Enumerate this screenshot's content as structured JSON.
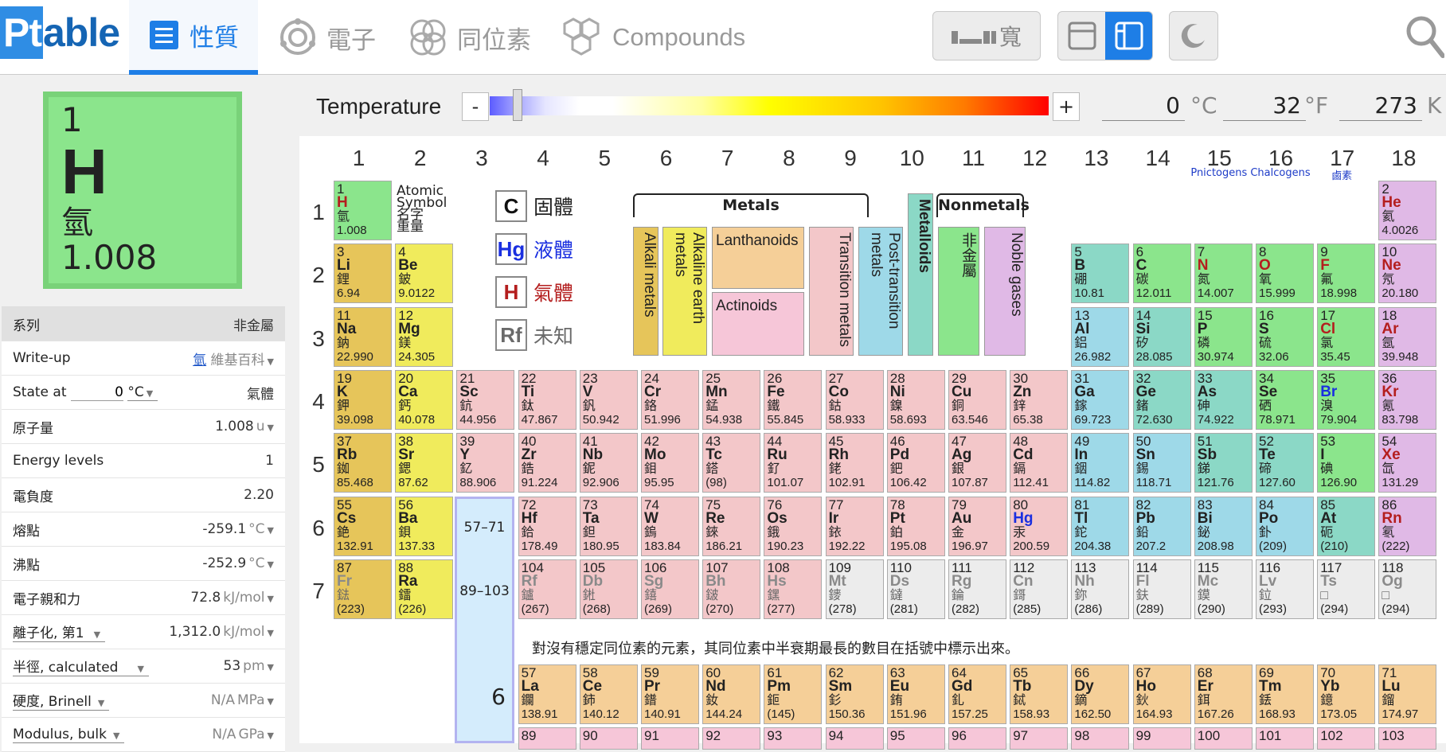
{
  "nav": {
    "logo": "Ptable",
    "logo_pt": "Pt",
    "logo_rest": "able",
    "tabs": [
      {
        "label": "性質",
        "icon": "list-icon",
        "active": true
      },
      {
        "label": "電子",
        "icon": "electron-icon",
        "active": false
      },
      {
        "label": "同位素",
        "icon": "isotope-icon",
        "active": false
      },
      {
        "label": "Compounds",
        "icon": "compound-icon",
        "active": false
      }
    ],
    "wide_label": "寬"
  },
  "selected": {
    "number": "1",
    "symbol": "H",
    "name": "氫",
    "mass": "1.008"
  },
  "props": {
    "series_label": "系列",
    "series_value": "非金屬",
    "writeup_label": "Write-up",
    "writeup_link": "氫",
    "writeup_source": "維基百科",
    "state_label": "State at",
    "state_temp": "0",
    "state_unit": "°C",
    "state_value": "氣體",
    "mass_label": "原子量",
    "mass_value": "1.008",
    "mass_unit": "u",
    "energy_label": "Energy levels",
    "energy_value": "1",
    "eneg_label": "電負度",
    "eneg_value": "2.20",
    "melt_label": "熔點",
    "melt_value": "-259.1",
    "melt_unit": "°C",
    "boil_label": "沸點",
    "boil_value": "-252.9",
    "boil_unit": "°C",
    "affinity_label": "電子親和力",
    "affinity_value": "72.8",
    "affinity_unit": "kJ/mol",
    "ion_label": "離子化, 第1",
    "ion_value": "1,312.0",
    "ion_unit": "kJ/mol",
    "radius_label": "半徑, calculated",
    "radius_value": "53",
    "radius_unit": "pm",
    "hardness_label": "硬度, Brinell",
    "hardness_value": "N/A",
    "hardness_unit": "MPa",
    "modulus_label": "Modulus, bulk",
    "modulus_value": "N/A",
    "modulus_unit": "GPa"
  },
  "temperature": {
    "label": "Temperature",
    "minus": "-",
    "plus": "+",
    "c_value": "0",
    "c_unit": "°C",
    "f_value": "32",
    "f_unit": "°F",
    "k_value": "273",
    "k_unit": "K"
  },
  "groups": [
    "1",
    "2",
    "3",
    "4",
    "5",
    "6",
    "7",
    "8",
    "9",
    "10",
    "11",
    "12",
    "13",
    "14",
    "15",
    "16",
    "17",
    "18"
  ],
  "group_subs": {
    "15": "Pnictogens",
    "16": "Chalcogens",
    "17": "鹵素"
  },
  "periods": [
    "1",
    "2",
    "3",
    "4",
    "5",
    "6",
    "7"
  ],
  "legend": {
    "atomic": "Atomic",
    "symbol": "Symbol",
    "name": "名字",
    "weight": "重量",
    "solid_sym": "C",
    "solid": "固體",
    "liquid_sym": "Hg",
    "liquid": "液體",
    "gas_sym": "H",
    "gas": "氣體",
    "unknown_sym": "Rf",
    "unknown": "未知",
    "metals": "Metals",
    "nonmetals": "Nonmetals",
    "alkali": "Alkali metals",
    "alkaline": "Alkaline earth metals",
    "lanthanoids": "Lanthanoids",
    "actinoids": "Actinoids",
    "transition": "Transition metals",
    "post": "Post-transition metals",
    "metalloids": "Metalloids",
    "nonmetal_cell": "非金屬",
    "noble": "Noble gases"
  },
  "lan_ranges": {
    "r57": "57–71",
    "r89": "89–103",
    "six": "6"
  },
  "note": "對沒有穩定同位素的元素，其同位素中半衰期最長的數目在括號中標示出來。",
  "colors": {
    "alkali": "#e6c55a",
    "alkaline": "#f0eb5c",
    "lanthanoid": "#f5cf98",
    "actinoid": "#f6c6d8",
    "transition": "#f3c7c9",
    "post": "#9ed9e8",
    "metalloid": "#8bd8c6",
    "nonmetal": "#8be58c",
    "noble": "#e0b9e6",
    "unknown": "#ececec",
    "accent": "#1e7ee6"
  },
  "elements": [
    [
      "1",
      "H",
      "氫",
      "1.008",
      1,
      1,
      "non",
      "gas"
    ],
    [
      "2",
      "He",
      "氦",
      "4.0026",
      1,
      18,
      "nob",
      "gas"
    ],
    [
      "3",
      "Li",
      "鋰",
      "6.94",
      2,
      1,
      "alk",
      ""
    ],
    [
      "4",
      "Be",
      "鈹",
      "9.0122",
      2,
      2,
      "aea",
      ""
    ],
    [
      "5",
      "B",
      "硼",
      "10.81",
      2,
      13,
      "met",
      ""
    ],
    [
      "6",
      "C",
      "碳",
      "12.011",
      2,
      14,
      "non",
      ""
    ],
    [
      "7",
      "N",
      "氮",
      "14.007",
      2,
      15,
      "non",
      "gas"
    ],
    [
      "8",
      "O",
      "氧",
      "15.999",
      2,
      16,
      "non",
      "gas"
    ],
    [
      "9",
      "F",
      "氟",
      "18.998",
      2,
      17,
      "non",
      "gas"
    ],
    [
      "10",
      "Ne",
      "氖",
      "20.180",
      2,
      18,
      "nob",
      "gas"
    ],
    [
      "11",
      "Na",
      "鈉",
      "22.990",
      3,
      1,
      "alk",
      ""
    ],
    [
      "12",
      "Mg",
      "鎂",
      "24.305",
      3,
      2,
      "aea",
      ""
    ],
    [
      "13",
      "Al",
      "鋁",
      "26.982",
      3,
      13,
      "ptm",
      ""
    ],
    [
      "14",
      "Si",
      "矽",
      "28.085",
      3,
      14,
      "met",
      ""
    ],
    [
      "15",
      "P",
      "磷",
      "30.974",
      3,
      15,
      "non",
      ""
    ],
    [
      "16",
      "S",
      "硫",
      "32.06",
      3,
      16,
      "non",
      ""
    ],
    [
      "17",
      "Cl",
      "氯",
      "35.45",
      3,
      17,
      "non",
      "gas"
    ],
    [
      "18",
      "Ar",
      "氬",
      "39.948",
      3,
      18,
      "nob",
      "gas"
    ],
    [
      "19",
      "K",
      "鉀",
      "39.098",
      4,
      1,
      "alk",
      ""
    ],
    [
      "20",
      "Ca",
      "鈣",
      "40.078",
      4,
      2,
      "aea",
      ""
    ],
    [
      "21",
      "Sc",
      "鈧",
      "44.956",
      4,
      3,
      "tm",
      ""
    ],
    [
      "22",
      "Ti",
      "鈦",
      "47.867",
      4,
      4,
      "tm",
      ""
    ],
    [
      "23",
      "V",
      "釩",
      "50.942",
      4,
      5,
      "tm",
      ""
    ],
    [
      "24",
      "Cr",
      "鉻",
      "51.996",
      4,
      6,
      "tm",
      ""
    ],
    [
      "25",
      "Mn",
      "錳",
      "54.938",
      4,
      7,
      "tm",
      ""
    ],
    [
      "26",
      "Fe",
      "鐵",
      "55.845",
      4,
      8,
      "tm",
      ""
    ],
    [
      "27",
      "Co",
      "鈷",
      "58.933",
      4,
      9,
      "tm",
      ""
    ],
    [
      "28",
      "Ni",
      "鎳",
      "58.693",
      4,
      10,
      "tm",
      ""
    ],
    [
      "29",
      "Cu",
      "銅",
      "63.546",
      4,
      11,
      "tm",
      ""
    ],
    [
      "30",
      "Zn",
      "鋅",
      "65.38",
      4,
      12,
      "tm",
      ""
    ],
    [
      "31",
      "Ga",
      "鎵",
      "69.723",
      4,
      13,
      "ptm",
      ""
    ],
    [
      "32",
      "Ge",
      "鍺",
      "72.630",
      4,
      14,
      "met",
      ""
    ],
    [
      "33",
      "As",
      "砷",
      "74.922",
      4,
      15,
      "met",
      ""
    ],
    [
      "34",
      "Se",
      "硒",
      "78.971",
      4,
      16,
      "non",
      ""
    ],
    [
      "35",
      "Br",
      "溴",
      "79.904",
      4,
      17,
      "non",
      "liq"
    ],
    [
      "36",
      "Kr",
      "氪",
      "83.798",
      4,
      18,
      "nob",
      "gas"
    ],
    [
      "37",
      "Rb",
      "銣",
      "85.468",
      5,
      1,
      "alk",
      ""
    ],
    [
      "38",
      "Sr",
      "鍶",
      "87.62",
      5,
      2,
      "aea",
      ""
    ],
    [
      "39",
      "Y",
      "釔",
      "88.906",
      5,
      3,
      "tm",
      ""
    ],
    [
      "40",
      "Zr",
      "鋯",
      "91.224",
      5,
      4,
      "tm",
      ""
    ],
    [
      "41",
      "Nb",
      "鈮",
      "92.906",
      5,
      5,
      "tm",
      ""
    ],
    [
      "42",
      "Mo",
      "鉬",
      "95.95",
      5,
      6,
      "tm",
      ""
    ],
    [
      "43",
      "Tc",
      "鎝",
      "(98)",
      5,
      7,
      "tm",
      ""
    ],
    [
      "44",
      "Ru",
      "釕",
      "101.07",
      5,
      8,
      "tm",
      ""
    ],
    [
      "45",
      "Rh",
      "銠",
      "102.91",
      5,
      9,
      "tm",
      ""
    ],
    [
      "46",
      "Pd",
      "鈀",
      "106.42",
      5,
      10,
      "tm",
      ""
    ],
    [
      "47",
      "Ag",
      "銀",
      "107.87",
      5,
      11,
      "tm",
      ""
    ],
    [
      "48",
      "Cd",
      "鎘",
      "112.41",
      5,
      12,
      "tm",
      ""
    ],
    [
      "49",
      "In",
      "銦",
      "114.82",
      5,
      13,
      "ptm",
      ""
    ],
    [
      "50",
      "Sn",
      "錫",
      "118.71",
      5,
      14,
      "ptm",
      ""
    ],
    [
      "51",
      "Sb",
      "銻",
      "121.76",
      5,
      15,
      "met",
      ""
    ],
    [
      "52",
      "Te",
      "碲",
      "127.60",
      5,
      16,
      "met",
      ""
    ],
    [
      "53",
      "I",
      "碘",
      "126.90",
      5,
      17,
      "non",
      ""
    ],
    [
      "54",
      "Xe",
      "氙",
      "131.29",
      5,
      18,
      "nob",
      "gas"
    ],
    [
      "55",
      "Cs",
      "銫",
      "132.91",
      6,
      1,
      "alk",
      ""
    ],
    [
      "56",
      "Ba",
      "鋇",
      "137.33",
      6,
      2,
      "aea",
      ""
    ],
    [
      "72",
      "Hf",
      "鉿",
      "178.49",
      6,
      4,
      "tm",
      ""
    ],
    [
      "73",
      "Ta",
      "鉭",
      "180.95",
      6,
      5,
      "tm",
      ""
    ],
    [
      "74",
      "W",
      "鎢",
      "183.84",
      6,
      6,
      "tm",
      ""
    ],
    [
      "75",
      "Re",
      "錸",
      "186.21",
      6,
      7,
      "tm",
      ""
    ],
    [
      "76",
      "Os",
      "鋨",
      "190.23",
      6,
      8,
      "tm",
      ""
    ],
    [
      "77",
      "Ir",
      "銥",
      "192.22",
      6,
      9,
      "tm",
      ""
    ],
    [
      "78",
      "Pt",
      "鉑",
      "195.08",
      6,
      10,
      "tm",
      ""
    ],
    [
      "79",
      "Au",
      "金",
      "196.97",
      6,
      11,
      "tm",
      ""
    ],
    [
      "80",
      "Hg",
      "汞",
      "200.59",
      6,
      12,
      "tm",
      "liq"
    ],
    [
      "81",
      "Tl",
      "鉈",
      "204.38",
      6,
      13,
      "ptm",
      ""
    ],
    [
      "82",
      "Pb",
      "鉛",
      "207.2",
      6,
      14,
      "ptm",
      ""
    ],
    [
      "83",
      "Bi",
      "鉍",
      "208.98",
      6,
      15,
      "ptm",
      ""
    ],
    [
      "84",
      "Po",
      "釙",
      "(209)",
      6,
      16,
      "ptm",
      ""
    ],
    [
      "85",
      "At",
      "砈",
      "(210)",
      6,
      17,
      "met",
      ""
    ],
    [
      "86",
      "Rn",
      "氡",
      "(222)",
      6,
      18,
      "nob",
      "gas"
    ],
    [
      "87",
      "Fr",
      "鍅",
      "(223)",
      7,
      1,
      "alk",
      "unk"
    ],
    [
      "88",
      "Ra",
      "鐳",
      "(226)",
      7,
      2,
      "aea",
      ""
    ],
    [
      "104",
      "Rf",
      "鑪",
      "(267)",
      7,
      4,
      "tm",
      "unk"
    ],
    [
      "105",
      "Db",
      "𨧀",
      "(268)",
      7,
      5,
      "tm",
      "unk"
    ],
    [
      "106",
      "Sg",
      "𨭎",
      "(269)",
      7,
      6,
      "tm",
      "unk"
    ],
    [
      "107",
      "Bh",
      "𨨏",
      "(270)",
      7,
      7,
      "tm",
      "unk"
    ],
    [
      "108",
      "Hs",
      "𨭆",
      "(277)",
      7,
      8,
      "tm",
      "unk"
    ],
    [
      "109",
      "Mt",
      "䥑",
      "(278)",
      7,
      9,
      "unk",
      "unk"
    ],
    [
      "110",
      "Ds",
      "鐽",
      "(281)",
      7,
      10,
      "unk",
      "unk"
    ],
    [
      "111",
      "Rg",
      "錀",
      "(282)",
      7,
      11,
      "unk",
      "unk"
    ],
    [
      "112",
      "Cn",
      "鎶",
      "(285)",
      7,
      12,
      "unk",
      "unk"
    ],
    [
      "113",
      "Nh",
      "鉨",
      "(286)",
      7,
      13,
      "unk",
      "unk"
    ],
    [
      "114",
      "Fl",
      "鈇",
      "(289)",
      7,
      14,
      "unk",
      "unk"
    ],
    [
      "115",
      "Mc",
      "鏌",
      "(290)",
      7,
      15,
      "unk",
      "unk"
    ],
    [
      "116",
      "Lv",
      "鉝",
      "(293)",
      7,
      16,
      "unk",
      "unk"
    ],
    [
      "117",
      "Ts",
      "□",
      "(294)",
      7,
      17,
      "unk",
      "unk"
    ],
    [
      "118",
      "Og",
      "□",
      "(294)",
      7,
      18,
      "unk",
      "unk"
    ],
    [
      "57",
      "La",
      "鑭",
      "138.91",
      9,
      4,
      "lan",
      ""
    ],
    [
      "58",
      "Ce",
      "鈰",
      "140.12",
      9,
      5,
      "lan",
      ""
    ],
    [
      "59",
      "Pr",
      "鐠",
      "140.91",
      9,
      6,
      "lan",
      ""
    ],
    [
      "60",
      "Nd",
      "釹",
      "144.24",
      9,
      7,
      "lan",
      ""
    ],
    [
      "61",
      "Pm",
      "鉕",
      "(145)",
      9,
      8,
      "lan",
      ""
    ],
    [
      "62",
      "Sm",
      "釤",
      "150.36",
      9,
      9,
      "lan",
      ""
    ],
    [
      "63",
      "Eu",
      "銪",
      "151.96",
      9,
      10,
      "lan",
      ""
    ],
    [
      "64",
      "Gd",
      "釓",
      "157.25",
      9,
      11,
      "lan",
      ""
    ],
    [
      "65",
      "Tb",
      "鋱",
      "158.93",
      9,
      12,
      "lan",
      ""
    ],
    [
      "66",
      "Dy",
      "鏑",
      "162.50",
      9,
      13,
      "lan",
      ""
    ],
    [
      "67",
      "Ho",
      "鈥",
      "164.93",
      9,
      14,
      "lan",
      ""
    ],
    [
      "68",
      "Er",
      "鉺",
      "167.26",
      9,
      15,
      "lan",
      ""
    ],
    [
      "69",
      "Tm",
      "銩",
      "168.93",
      9,
      16,
      "lan",
      ""
    ],
    [
      "70",
      "Yb",
      "鐿",
      "173.05",
      9,
      17,
      "lan",
      ""
    ],
    [
      "71",
      "Lu",
      "鎦",
      "174.97",
      9,
      18,
      "lan",
      ""
    ],
    [
      "89",
      "",
      "",
      "",
      10,
      4,
      "act",
      ""
    ],
    [
      "90",
      "",
      "",
      "",
      10,
      5,
      "act",
      ""
    ],
    [
      "91",
      "",
      "",
      "",
      10,
      6,
      "act",
      ""
    ],
    [
      "92",
      "",
      "",
      "",
      10,
      7,
      "act",
      ""
    ],
    [
      "93",
      "",
      "",
      "",
      10,
      8,
      "act",
      ""
    ],
    [
      "94",
      "",
      "",
      "",
      10,
      9,
      "act",
      ""
    ],
    [
      "95",
      "",
      "",
      "",
      10,
      10,
      "act",
      ""
    ],
    [
      "96",
      "",
      "",
      "",
      10,
      11,
      "act",
      ""
    ],
    [
      "97",
      "",
      "",
      "",
      10,
      12,
      "act",
      ""
    ],
    [
      "98",
      "",
      "",
      "",
      10,
      13,
      "act",
      ""
    ],
    [
      "99",
      "",
      "",
      "",
      10,
      14,
      "act",
      ""
    ],
    [
      "100",
      "",
      "",
      "",
      10,
      15,
      "act",
      ""
    ],
    [
      "101",
      "",
      "",
      "",
      10,
      16,
      "act",
      ""
    ],
    [
      "102",
      "",
      "",
      "",
      10,
      17,
      "act",
      ""
    ],
    [
      "103",
      "",
      "",
      "",
      10,
      18,
      "act",
      ""
    ]
  ]
}
